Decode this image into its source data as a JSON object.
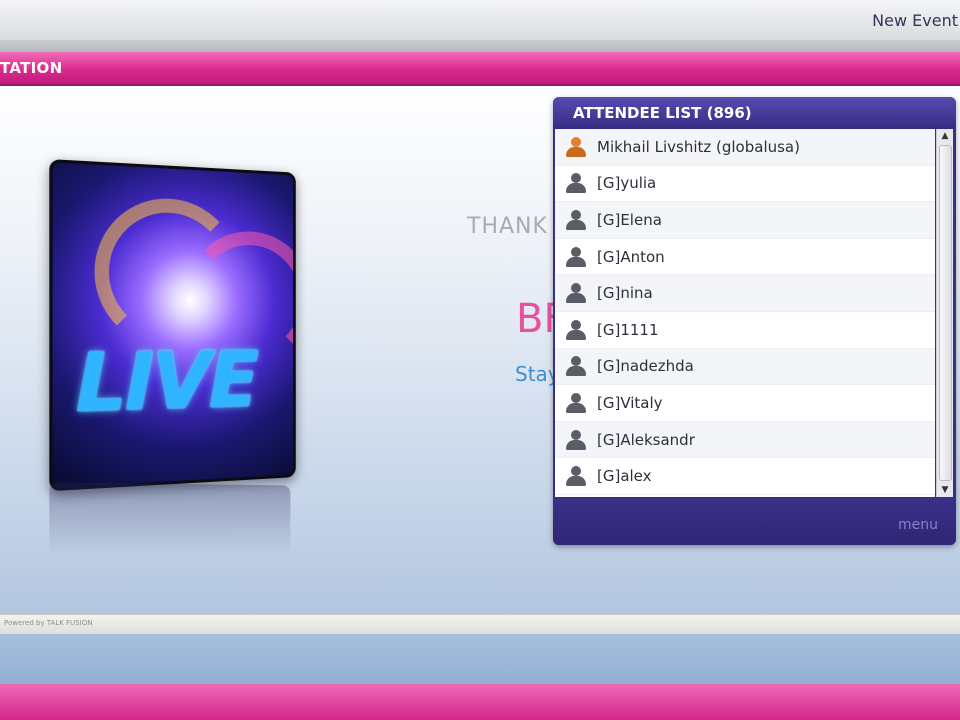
{
  "topbar": {
    "new_event": "New Event"
  },
  "banner": {
    "title": "TATION"
  },
  "stage": {
    "live_label": "LIVE",
    "thank_text": "THANK",
    "bf_text": "BF",
    "stay_text": "Stay"
  },
  "attendee_list": {
    "title": "ATTENDEE LIST (896)",
    "items": [
      {
        "name": "Mikhail Livshitz (globalusa)",
        "role": "host"
      },
      {
        "name": "[G]yulia",
        "role": "guest"
      },
      {
        "name": "[G]Elena",
        "role": "guest"
      },
      {
        "name": "[G]Anton",
        "role": "guest"
      },
      {
        "name": "[G]nina",
        "role": "guest"
      },
      {
        "name": "[G]1111",
        "role": "guest"
      },
      {
        "name": "[G]nadezhda",
        "role": "guest"
      },
      {
        "name": "[G]Vitaly",
        "role": "guest"
      },
      {
        "name": "[G]Aleksandr",
        "role": "guest"
      },
      {
        "name": "[G]alex",
        "role": "guest"
      }
    ],
    "menu_label": "menu"
  },
  "footer": {
    "powered_by": "Powered by TALK FUSION"
  },
  "colors": {
    "accent_pink": "#d92b8e",
    "panel_purple": "#3a2f86"
  }
}
